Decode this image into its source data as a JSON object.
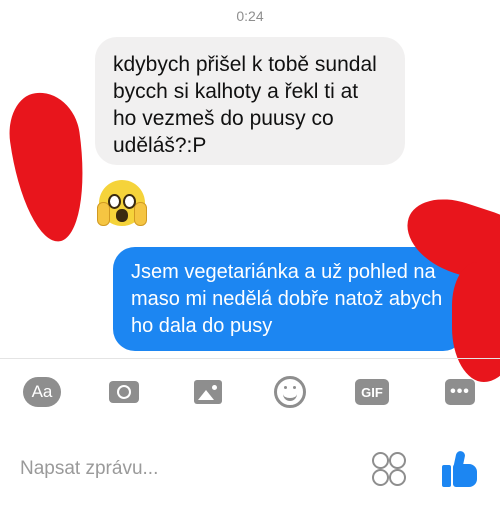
{
  "conversation": {
    "timestamp": "0:24",
    "incoming_message": "kdybych přišel k tobě sundal bycch si kalhoty a řekl ti at ho vezmeš do puusy co uděláš?:P",
    "incoming_reaction_icon": "screaming-face-emoji",
    "outgoing_message": "Jsem vegetariánka a už pohled na maso mi nedělá dobře natož abych ho dala do pusy"
  },
  "toolbar": {
    "text_style_label": "Aa",
    "gif_label": "GIF",
    "more_label": "•••",
    "icons": [
      "text-style-icon",
      "camera-icon",
      "image-icon",
      "emoji-icon",
      "gif-icon",
      "more-icon"
    ]
  },
  "composer": {
    "placeholder": "Napsat zprávu...",
    "sticker_icon": "sticker-icon",
    "like_icon": "thumbs-up-icon"
  },
  "colors": {
    "outgoing_bubble": "#1c86f2",
    "incoming_bubble": "#f1f0f0",
    "redaction_marks": "#e8151c",
    "icon_gray": "#8e8e8e"
  }
}
